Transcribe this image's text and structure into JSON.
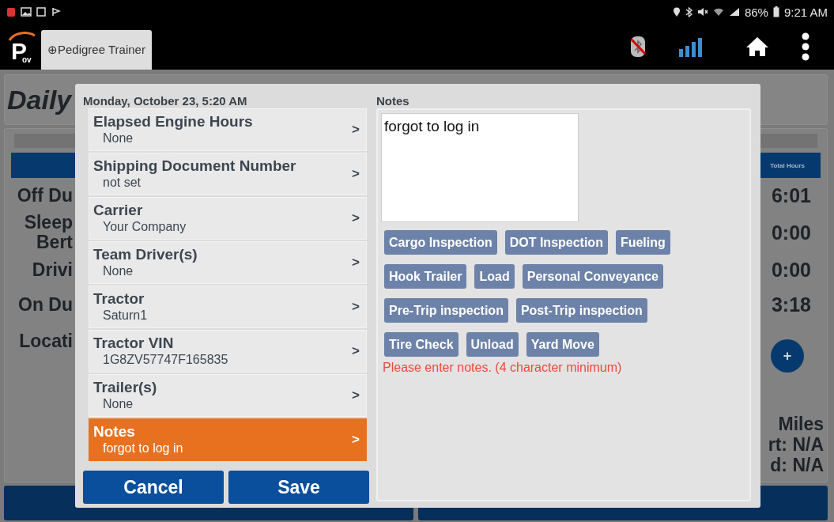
{
  "status_bar": {
    "battery": "86%",
    "time": "9:21 AM"
  },
  "app_bar": {
    "logo": {
      "letter": "P",
      "sub": "ov"
    },
    "tab": "⊕Pedigree Trainer"
  },
  "background": {
    "title": "Daily",
    "table_header": "Total Hours",
    "rows": [
      {
        "label": [
          "Off Du"
        ],
        "total": "6:01"
      },
      {
        "label": [
          "Sleep",
          "Bert"
        ],
        "total": "0:00"
      },
      {
        "label": [
          "Drivi"
        ],
        "total": "0:00"
      },
      {
        "label": [
          "On Du"
        ],
        "total": "3:18"
      }
    ],
    "location_label": "Locati",
    "add_button": "+",
    "miles": [
      "Miles",
      "rt: N/A",
      "d: N/A"
    ]
  },
  "dialog": {
    "timestamp": "Monday, October 23, 5:20 AM",
    "fields": [
      {
        "label": "Elapsed Engine Hours",
        "value": "None",
        "arrow": ">",
        "selected": false
      },
      {
        "label": "Shipping Document Number",
        "value": "not set",
        "arrow": ">",
        "selected": false
      },
      {
        "label": "Carrier",
        "value": "Your Company",
        "arrow": ">",
        "selected": false
      },
      {
        "label": "Team Driver(s)",
        "value": "None",
        "arrow": ">",
        "selected": false
      },
      {
        "label": "Tractor",
        "value": "Saturn1",
        "arrow": ">",
        "selected": false
      },
      {
        "label": "Tractor VIN",
        "value": "1G8ZV57747F165835",
        "arrow": ">",
        "selected": false
      },
      {
        "label": "Trailer(s)",
        "value": "None",
        "arrow": ">",
        "selected": false
      },
      {
        "label": "Notes",
        "value": "forgot to log in",
        "arrow": ">",
        "selected": true
      }
    ],
    "notes_label": "Notes",
    "notes_value": "forgot to log in",
    "quick_notes": [
      [
        "Cargo Inspection",
        "DOT Inspection",
        "Fueling"
      ],
      [
        "Hook Trailer",
        "Load",
        "Personal Conveyance"
      ],
      [
        "Pre-Trip inspection",
        "Post-Trip inspection"
      ],
      [
        "Tire Check",
        "Unload",
        "Yard Move"
      ]
    ],
    "error": "Please enter notes. (4 character minimum)",
    "buttons": [
      "Cancel",
      "Save"
    ]
  }
}
